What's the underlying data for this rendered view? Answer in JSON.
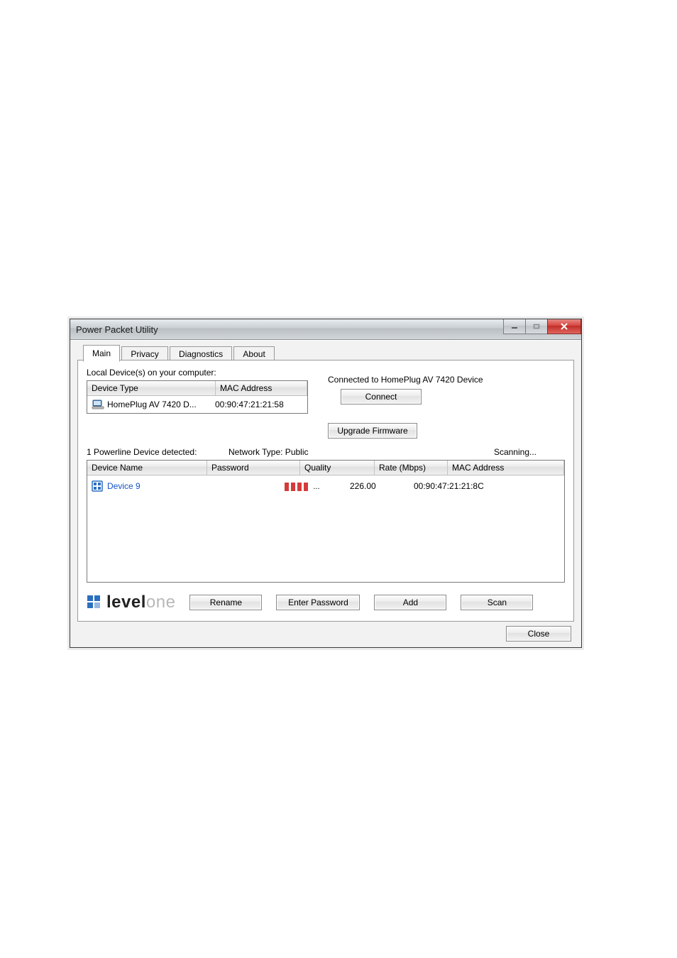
{
  "window": {
    "title": "Power Packet Utility"
  },
  "tabs": {
    "main": "Main",
    "privacy": "Privacy",
    "diagnostics": "Diagnostics",
    "about": "About"
  },
  "local": {
    "label": "Local Device(s) on your computer:",
    "hdr_type": "Device Type",
    "hdr_mac": "MAC Address",
    "row_type": "HomePlug AV 7420 D...",
    "row_mac": "00:90:47:21:21:58"
  },
  "connect": {
    "status": "Connected to HomePlug AV 7420 Device",
    "connect_btn": "Connect",
    "upgrade_btn": "Upgrade Firmware"
  },
  "status": {
    "detected": "1 Powerline Device detected:",
    "nettype": "Network Type: Public",
    "scanning": "Scanning..."
  },
  "devhdr": {
    "name": "Device Name",
    "pass": "Password",
    "qual": "Quality",
    "rate": "Rate (Mbps)",
    "mac": "MAC Address"
  },
  "devrow": {
    "name": "Device 9",
    "rate": "226.00",
    "mac": "00:90:47:21:21:8C"
  },
  "buttons": {
    "rename": "Rename",
    "enter_password": "Enter Password",
    "add": "Add",
    "scan": "Scan",
    "close": "Close"
  },
  "logo": {
    "dark": "level",
    "lite": "one"
  }
}
